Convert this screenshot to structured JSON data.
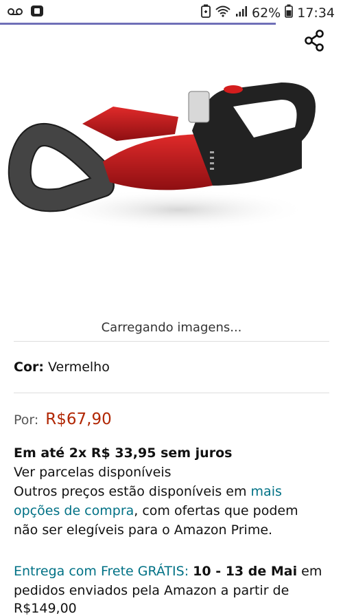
{
  "status": {
    "battery_percent": "62%",
    "time": "17:34"
  },
  "loading": {
    "text": "Carregando imagens..."
  },
  "product": {
    "color_label": "Cor:",
    "color_value": "Vermelho",
    "price_label": "Por:",
    "price_value": "R$67,90",
    "installments": "Em até 2x R$ 33,95 sem juros",
    "installments_link": "Ver parcelas disponíveis",
    "other_prices_1": "Outros preços estão disponíveis em",
    "other_prices_link_1": "mais",
    "other_prices_link_2": "opções de compra",
    "other_prices_2": ", com ofertas que podem",
    "other_prices_3": "não ser elegíveis para o Amazon Prime.",
    "delivery_link": "Entrega com Frete GRÁTIS:",
    "delivery_dates": "10 - 13 de Mai",
    "delivery_suffix": "em",
    "delivery_line2": "pedidos enviados pela Amazon a partir de",
    "delivery_line3": "R$149,00"
  },
  "colors": {
    "price": "#b12704",
    "link": "#007185",
    "progress": "#6f6fb8"
  },
  "icons": [
    "voicemail-icon",
    "screen-cast-icon",
    "battery-saver-icon",
    "wifi-icon",
    "signal-icon",
    "battery-icon",
    "share-icon"
  ]
}
